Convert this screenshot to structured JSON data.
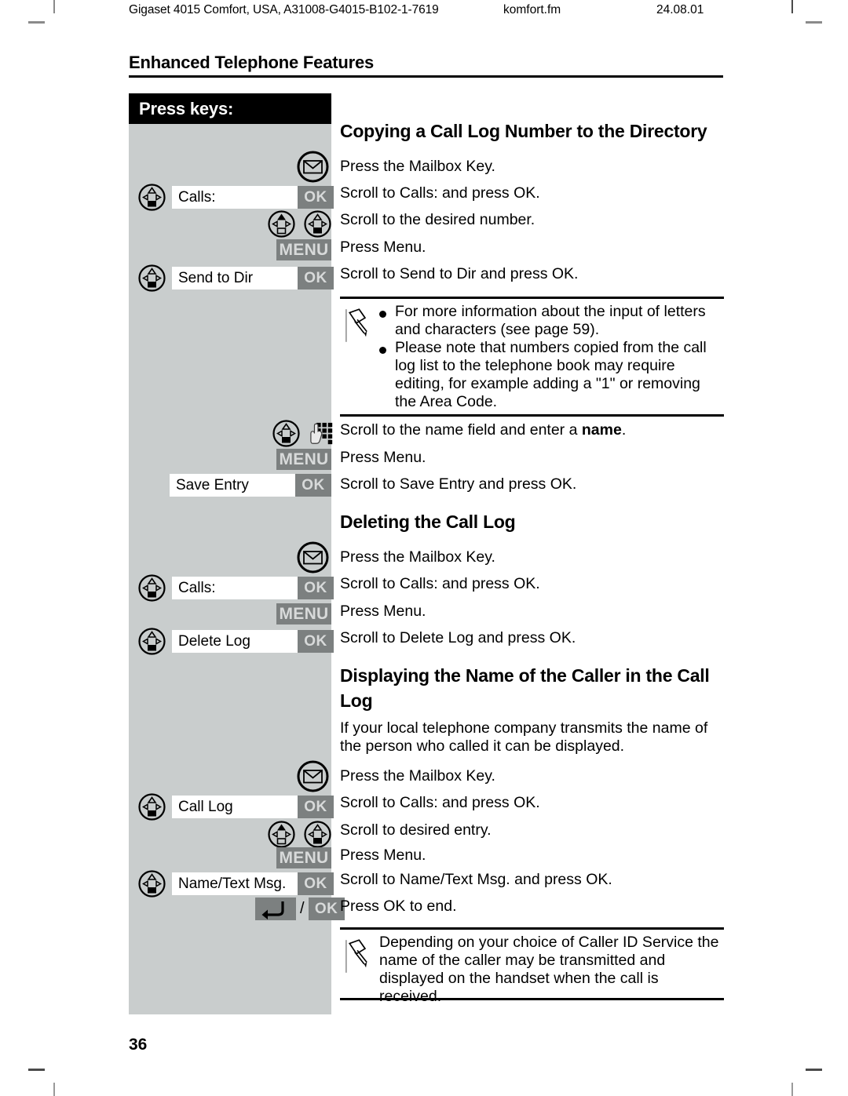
{
  "crop_marks": {
    "present": true
  },
  "running_header": {
    "document": "Gigaset 4015 Comfort, USA, A31008-G4015-B102-1-7619",
    "filename": "komfort.fm",
    "date": "24.08.01"
  },
  "chapter_title": "Enhanced Telephone Features",
  "page_number": "36",
  "keys_column": {
    "header": "Press keys:",
    "lcd_labels": {
      "calls_1": "Calls:",
      "send_to_dir": "Send to Dir",
      "save_entry": "Save Entry",
      "calls_2": "Calls:",
      "delete_log": "Delete Log",
      "call_log": "Call Log",
      "name_text_msg": "Name/Text Msg."
    },
    "buttons": {
      "ok": "OK",
      "menu": "MENU",
      "slash": "/"
    },
    "icons": {
      "mailbox": "mailbox-key-icon",
      "nav_down": "navigation-key-down-icon",
      "nav_up": "navigation-key-up-icon",
      "keypad": "keypad-entry-icon",
      "back": "back-key-icon"
    }
  },
  "sections": [
    {
      "id": "copying",
      "heading": "Copying a Call Log Number to the Directory",
      "steps": [
        "Press the Mailbox Key.",
        "Scroll to Calls: and press OK.",
        "Scroll to the desired number.",
        "Press Menu.",
        "Scroll to Send to Dir and press OK."
      ]
    },
    {
      "id": "copying-cont",
      "steps": [
        "Press Menu.",
        "Scroll to Save Entry and press OK."
      ],
      "step_with_bold": {
        "prefix": "Scroll to the name field and enter a ",
        "bold": "name",
        "suffix": "."
      }
    },
    {
      "id": "deleting",
      "heading": "Deleting the Call Log",
      "steps": [
        "Press the Mailbox Key.",
        "Scroll to Calls: and press OK.",
        "Press Menu.",
        "Scroll to Delete Log and press OK."
      ]
    },
    {
      "id": "displaying",
      "heading": "Displaying the Name of the Caller in the Call Log",
      "intro": "If your local telephone company transmits the name of the person who called it can be displayed.",
      "steps": [
        "Press the Mailbox Key.",
        "Scroll to Calls: and press OK.",
        "Scroll to desired entry.",
        "Press Menu.",
        "Scroll to Name/Text Msg. and press OK.",
        "Press OK to end."
      ]
    }
  ],
  "notes": [
    {
      "id": "note-1",
      "icon": "push-pin-icon",
      "bullets": [
        "For more information about the input of letters and characters (see page 59).",
        "Please note that numbers copied from the call log list to the telephone book may require editing, for example adding a \"1\" or removing the Area Code."
      ]
    },
    {
      "id": "note-2",
      "icon": "push-pin-icon",
      "text": "Depending on your choice of Caller ID Service the name of the caller may be transmitted and displayed on the handset when the call is received."
    }
  ],
  "colors": {
    "panel_gray": "#c9cdcd",
    "button_gray": "#7c8080",
    "button_text": "#d8dada",
    "header_black": "#000000"
  }
}
